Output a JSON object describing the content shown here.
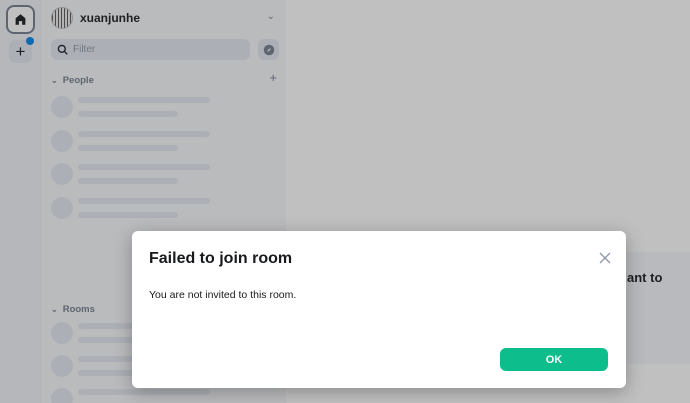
{
  "user": {
    "name": "xuanjunhe"
  },
  "filter": {
    "placeholder": "Filter"
  },
  "sections": {
    "people": {
      "label": "People"
    },
    "rooms": {
      "label": "Rooms"
    }
  },
  "main": {
    "partial_text": "ant to"
  },
  "dialog": {
    "title": "Failed to join room",
    "message": "You are not invited to this room.",
    "ok_label": "OK"
  },
  "colors": {
    "accent": "#0dbd8b",
    "notification_dot": "#0086e6"
  },
  "icons": [
    "home-icon",
    "plus-icon",
    "search-icon",
    "compass-icon",
    "chevron-down-icon",
    "close-icon"
  ]
}
